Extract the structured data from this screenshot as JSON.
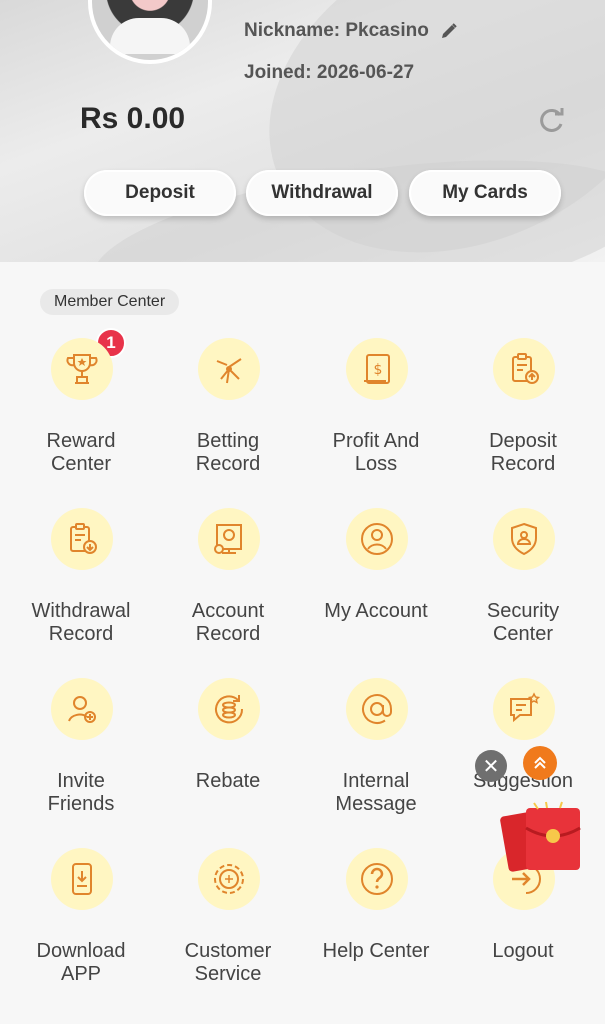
{
  "profile": {
    "nickname": "Nickname: Pkcasino",
    "joined": "Joined:  2026-06-27",
    "balance": "Rs 0.00"
  },
  "actions": {
    "deposit": "Deposit",
    "withdrawal": "Withdrawal",
    "my_cards": "My Cards"
  },
  "section": {
    "member_center": "Member Center"
  },
  "menu": [
    {
      "label": "Reward\nCenter",
      "icon": "trophy-icon"
    },
    {
      "label": "Betting\nRecord",
      "icon": "betting-icon"
    },
    {
      "label": "Profit And\nLoss",
      "icon": "profit-icon"
    },
    {
      "label": "Deposit\nRecord",
      "icon": "deposit-record-icon"
    },
    {
      "label": "Withdrawal\nRecord",
      "icon": "withdrawal-record-icon"
    },
    {
      "label": "Account\nRecord",
      "icon": "account-record-icon"
    },
    {
      "label": "My Account",
      "icon": "user-icon"
    },
    {
      "label": "Security\nCenter",
      "icon": "shield-icon"
    },
    {
      "label": "Invite\nFriends",
      "icon": "invite-icon"
    },
    {
      "label": "Rebate",
      "icon": "coins-icon"
    },
    {
      "label": "Internal\nMessage",
      "icon": "at-icon"
    },
    {
      "label": "Suggestion",
      "icon": "suggestion-icon"
    },
    {
      "label": "Download\nAPP",
      "icon": "download-icon"
    },
    {
      "label": "Customer\nService",
      "icon": "support-icon"
    },
    {
      "label": "Help Center",
      "icon": "help-icon"
    },
    {
      "label": "Logout",
      "icon": "logout-icon"
    }
  ],
  "badge": {
    "reward_count": "1"
  },
  "colors": {
    "accent": "#e0852c",
    "icon_bg": "#fff6c2",
    "badge": "#e8334a"
  }
}
